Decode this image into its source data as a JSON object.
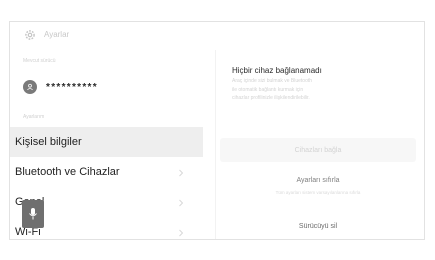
{
  "header": {
    "title": "Ayarlar"
  },
  "driver": {
    "section_label": "Mevcut sürücü",
    "name": "**********"
  },
  "settings": {
    "section_label": "Ayarlarım",
    "items": [
      {
        "label": "Kişisel bilgiler",
        "selected": true
      },
      {
        "label": "Bluetooth ve Cihazlar",
        "selected": false
      },
      {
        "label": "Genel",
        "selected": false
      },
      {
        "label": "Wi-Fi",
        "selected": false
      }
    ]
  },
  "detail": {
    "title": "Hiçbir cihaz bağlanamadı",
    "description_lines": [
      "Araç içinde sizi bulmak ve Bluetooth",
      "ile otomatik bağlantı kurmak için",
      "cihazlar profilinizle ilişkilendirilebilir."
    ],
    "connect_button": "Cihazları bağla",
    "reset_button": "Ayarları sıfırla",
    "reset_note": "Tüm ayarları sistem varsayılanlarına sıfırla",
    "delete_button": "Sürücüyü sil"
  },
  "icons": {
    "settings": "gear-icon",
    "avatar": "person-icon",
    "chevron": "chevron-right-icon",
    "voice": "microphone-icon"
  },
  "colors": {
    "selected_row": "#eeeeee",
    "mic_button": "#6f6f6f",
    "avatar": "#7a7a7a"
  }
}
